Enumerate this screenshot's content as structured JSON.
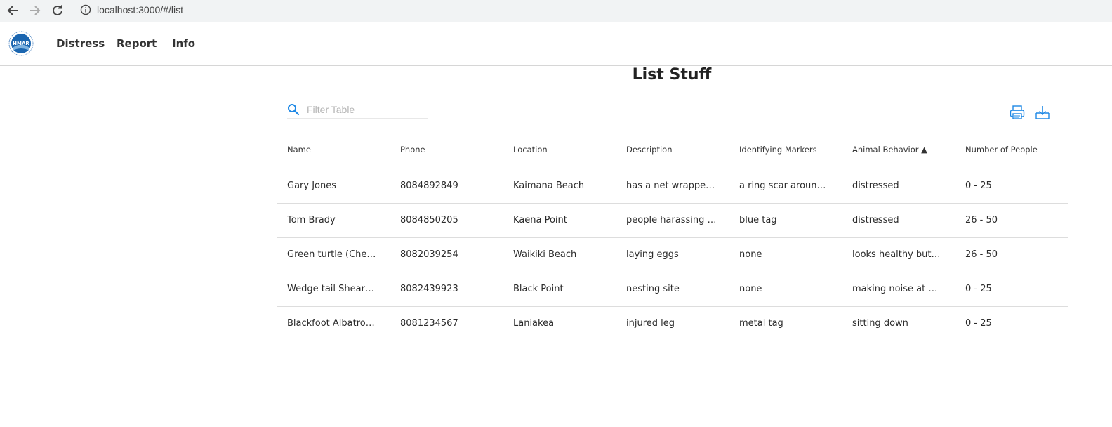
{
  "browser": {
    "url": "localhost:3000/#/list"
  },
  "nav": {
    "logo_text": "HMAR",
    "items": [
      {
        "label": "Distress"
      },
      {
        "label": "Report"
      },
      {
        "label": "Info"
      }
    ]
  },
  "page": {
    "title": "List Stuff"
  },
  "toolbar": {
    "filter_placeholder": "Filter Table",
    "filter_value": "",
    "print_icon": "printer-icon",
    "download_icon": "download-icon"
  },
  "colors": {
    "accent": "#1e88e5"
  },
  "table": {
    "columns": [
      "Name",
      "Phone",
      "Location",
      "Description",
      "Identifying Markers",
      "Animal Behavior ▲",
      "Number of People"
    ],
    "rows": [
      [
        "Gary Jones",
        "8084892849",
        "Kaimana Beach",
        "has a net wrapped ar...",
        "a ring scar around ne...",
        "distressed",
        "0 - 25"
      ],
      [
        "Tom Brady",
        "8084850205",
        "Kaena Point",
        "people harassing sea...",
        "blue tag",
        "distressed",
        "26 - 50"
      ],
      [
        "Green turtle (Chelon...",
        "8082039254",
        "Waikiki Beach",
        "laying eggs",
        "none",
        "looks healthy but pe...",
        "26 - 50"
      ],
      [
        "Wedge tail Shearwat...",
        "8082439923",
        "Black Point",
        "nesting site",
        "none",
        "making noise at night.",
        "0 - 25"
      ],
      [
        "Blackfoot Albatross ...",
        "8081234567",
        "Laniakea",
        "injured leg",
        "metal tag",
        "sitting down",
        "0 - 25"
      ]
    ]
  }
}
